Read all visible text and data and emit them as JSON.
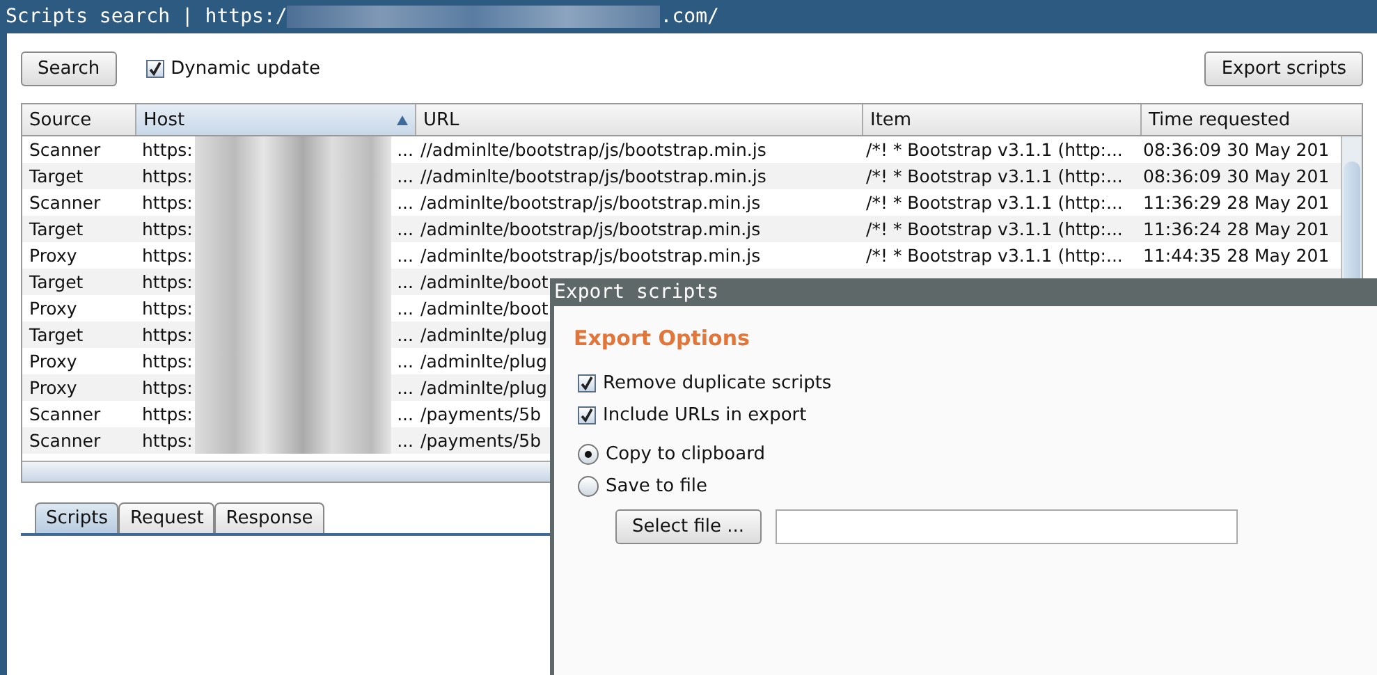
{
  "window": {
    "title": "Scripts search | https:/",
    "title_end": ".com/"
  },
  "toolbar": {
    "search_button": "Search",
    "dynamic_update": {
      "label": "Dynamic update",
      "checked": true
    },
    "export_button": "Export scripts"
  },
  "table": {
    "columns": [
      {
        "label": "Source",
        "sorted": false
      },
      {
        "label": "Host",
        "sorted": true
      },
      {
        "label": "URL",
        "sorted": false
      },
      {
        "label": "Item",
        "sorted": false
      },
      {
        "label": "Time requested",
        "sorted": false
      }
    ],
    "rows": [
      {
        "source": "Scanner",
        "host": "https:",
        "host_end": "...",
        "url": "//adminlte/bootstrap/js/bootstrap.min.js",
        "item": "/*! * Bootstrap v3.1.1 (http:...",
        "time": "08:36:09 30 May 201"
      },
      {
        "source": "Target",
        "host": "https:",
        "host_end": "...",
        "url": "//adminlte/bootstrap/js/bootstrap.min.js",
        "item": "/*! * Bootstrap v3.1.1 (http:...",
        "time": "08:36:09 30 May 201"
      },
      {
        "source": "Scanner",
        "host": "https:",
        "host_end": "...",
        "url": "/adminlte/bootstrap/js/bootstrap.min.js",
        "item": "/*! * Bootstrap v3.1.1 (http:...",
        "time": "11:36:29 28 May 201"
      },
      {
        "source": "Target",
        "host": "https:",
        "host_end": "...",
        "url": "/adminlte/bootstrap/js/bootstrap.min.js",
        "item": "/*! * Bootstrap v3.1.1 (http:...",
        "time": "11:36:24 28 May 201"
      },
      {
        "source": "Proxy",
        "host": "https:",
        "host_end": "...",
        "url": "/adminlte/bootstrap/js/bootstrap.min.js",
        "item": "/*! * Bootstrap v3.1.1 (http:...",
        "time": "11:44:35 28 May 201"
      },
      {
        "source": "Target",
        "host": "https:",
        "host_end": "...",
        "url": "/adminlte/boot"
      },
      {
        "source": "Proxy",
        "host": "https:",
        "host_end": "...",
        "url": "/adminlte/boot"
      },
      {
        "source": "Target",
        "host": "https:",
        "host_end": "...",
        "url": "/adminlte/plug"
      },
      {
        "source": "Proxy",
        "host": "https:",
        "host_end": "...",
        "url": "/adminlte/plug"
      },
      {
        "source": "Proxy",
        "host": "https:",
        "host_end": "...",
        "url": "/adminlte/plug"
      },
      {
        "source": "Scanner",
        "host": "https:",
        "host_end": "...",
        "url": "/payments/5b"
      },
      {
        "source": "Scanner",
        "host": "https:",
        "host_end": "...",
        "url": "/payments/5b"
      }
    ]
  },
  "tabs": [
    {
      "label": "Scripts",
      "selected": true
    },
    {
      "label": "Request",
      "selected": false
    },
    {
      "label": "Response",
      "selected": false
    }
  ],
  "dialog": {
    "title": "Export scripts",
    "heading": "Export Options",
    "options": [
      {
        "kind": "checkbox",
        "label": "Remove duplicate scripts",
        "checked": true
      },
      {
        "kind": "checkbox",
        "label": "Include URLs in export",
        "checked": true
      },
      {
        "kind": "radio",
        "label": "Copy to clipboard",
        "checked": true
      },
      {
        "kind": "radio",
        "label": "Save to file",
        "checked": false
      }
    ],
    "select_button": "Select file ..."
  }
}
